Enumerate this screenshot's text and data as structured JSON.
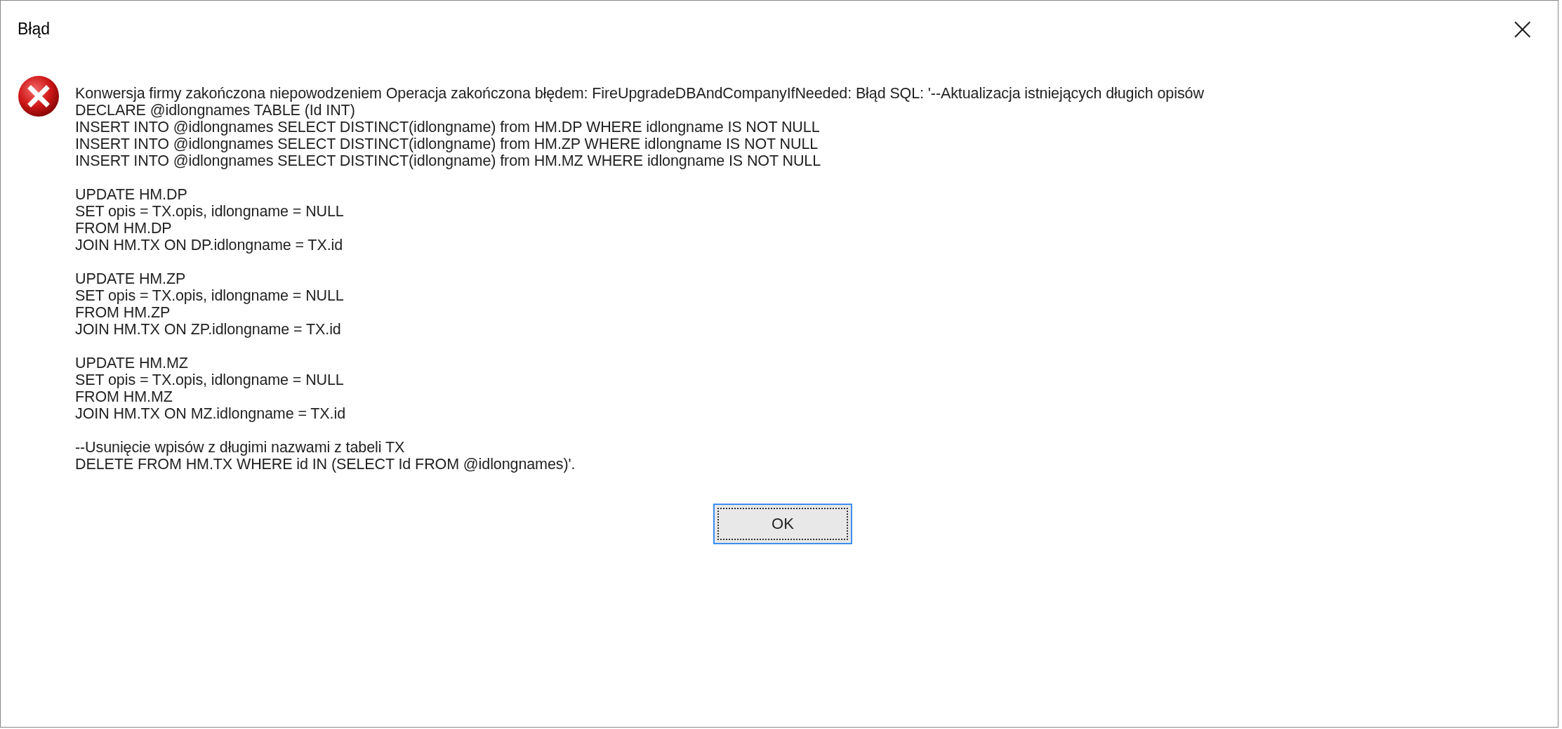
{
  "window": {
    "title": "Błąd",
    "close": "×"
  },
  "message": "Konwersja firmy zakończona niepowodzeniem Operacja zakończona błędem: FireUpgradeDBAndCompanyIfNeeded: Błąd SQL: '--Aktualizacja istniejących długich opisów\nDECLARE @idlongnames TABLE (Id INT)\nINSERT INTO @idlongnames SELECT DISTINCT(idlongname) from HM.DP WHERE idlongname IS NOT NULL\nINSERT INTO @idlongnames SELECT DISTINCT(idlongname) from HM.ZP WHERE idlongname IS NOT NULL\nINSERT INTO @idlongnames SELECT DISTINCT(idlongname) from HM.MZ WHERE idlongname IS NOT NULL\n\nUPDATE HM.DP\nSET opis = TX.opis, idlongname = NULL\nFROM HM.DP\nJOIN HM.TX ON DP.idlongname = TX.id\n\nUPDATE HM.ZP\nSET opis = TX.opis, idlongname = NULL\nFROM HM.ZP\nJOIN HM.TX ON ZP.idlongname = TX.id\n\nUPDATE HM.MZ\nSET opis = TX.opis, idlongname = NULL\nFROM HM.MZ\nJOIN HM.TX ON MZ.idlongname = TX.id\n\n--Usunięcie wpisów z długimi nazwami z tabeli TX\nDELETE FROM HM.TX WHERE id IN (SELECT Id FROM @idlongnames)'.",
  "buttons": [
    {
      "label": "OK",
      "focused": true
    }
  ]
}
